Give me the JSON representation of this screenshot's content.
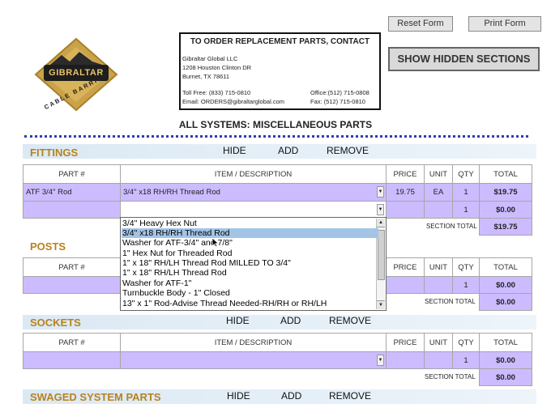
{
  "logo": {
    "brand": "GIBRALTAR",
    "sub": "CABLE BARRIER"
  },
  "toolbar": {
    "reset_label": "Reset Form",
    "print_label": "Print Form",
    "show_hidden_label": "SHOW HIDDEN SECTIONS"
  },
  "contact": {
    "heading": "TO ORDER REPLACEMENT PARTS, CONTACT",
    "company": "Gibraltar Global LLC",
    "address1": "1208 Houston Clinton DR",
    "address2": "Burnet, TX 78611",
    "tollfree": "Toll Free: (833) 715-0810",
    "office": "Office:(512) 715-0808",
    "email": "Email: ORDERS@gibraltarglobal.com",
    "fax": "Fax: (512) 715-0810"
  },
  "page_title": "ALL SYSTEMS: MISCELLANEOUS PARTS",
  "actions": {
    "hide": "HIDE",
    "add": "ADD",
    "remove": "REMOVE"
  },
  "columns": {
    "part": "PART #",
    "item": "ITEM / DESCRIPTION",
    "price": "PRICE",
    "unit": "UNIT",
    "qty": "QTY",
    "total": "TOTAL"
  },
  "section_total_label": "SECTION TOTAL",
  "sections": {
    "fittings": {
      "title": "FITTINGS",
      "rows": [
        {
          "part": "ATF 3/4\" Rod",
          "item": "3/4\" x18 RH/RH Thread Rod",
          "price": "19.75",
          "unit": "EA",
          "qty": "1",
          "total": "$19.75"
        },
        {
          "part": "",
          "item": "",
          "price": "",
          "unit": "",
          "qty": "1",
          "total": "$0.00"
        }
      ],
      "section_total": "$19.75"
    },
    "posts": {
      "title": "POSTS",
      "rows": [
        {
          "qty": "1",
          "total": "$0.00"
        }
      ],
      "section_total": "$0.00"
    },
    "sockets": {
      "title": "SOCKETS",
      "rows": [
        {
          "qty": "1",
          "total": "$0.00"
        }
      ],
      "section_total": "$0.00"
    },
    "swaged": {
      "title": "SWAGED SYSTEM PARTS"
    }
  },
  "dropdown_options": [
    "3/4\" Heavy Hex Nut",
    "3/4\" x18 RH/RH Thread Rod",
    "Washer for ATF-3/4\" and 7/8\"",
    "1\" Hex Nut for Threaded Rod",
    "1\" x 18\" RH/LH Thread Rod MILLED TO 3/4\"",
    "1\" x 18\" RH/LH Thread Rod",
    "Washer for ATF-1\"",
    "Turnbuckle Body - 1\" Closed",
    "13\" x 1\" Rod-Advise Thread Needed-RH/RH or RH/LH"
  ],
  "colors": {
    "row_fill": "#ccbcff",
    "section_title": "#b8821e",
    "selected_option": "#a3c4e6",
    "dots": "#2a3fb0"
  }
}
